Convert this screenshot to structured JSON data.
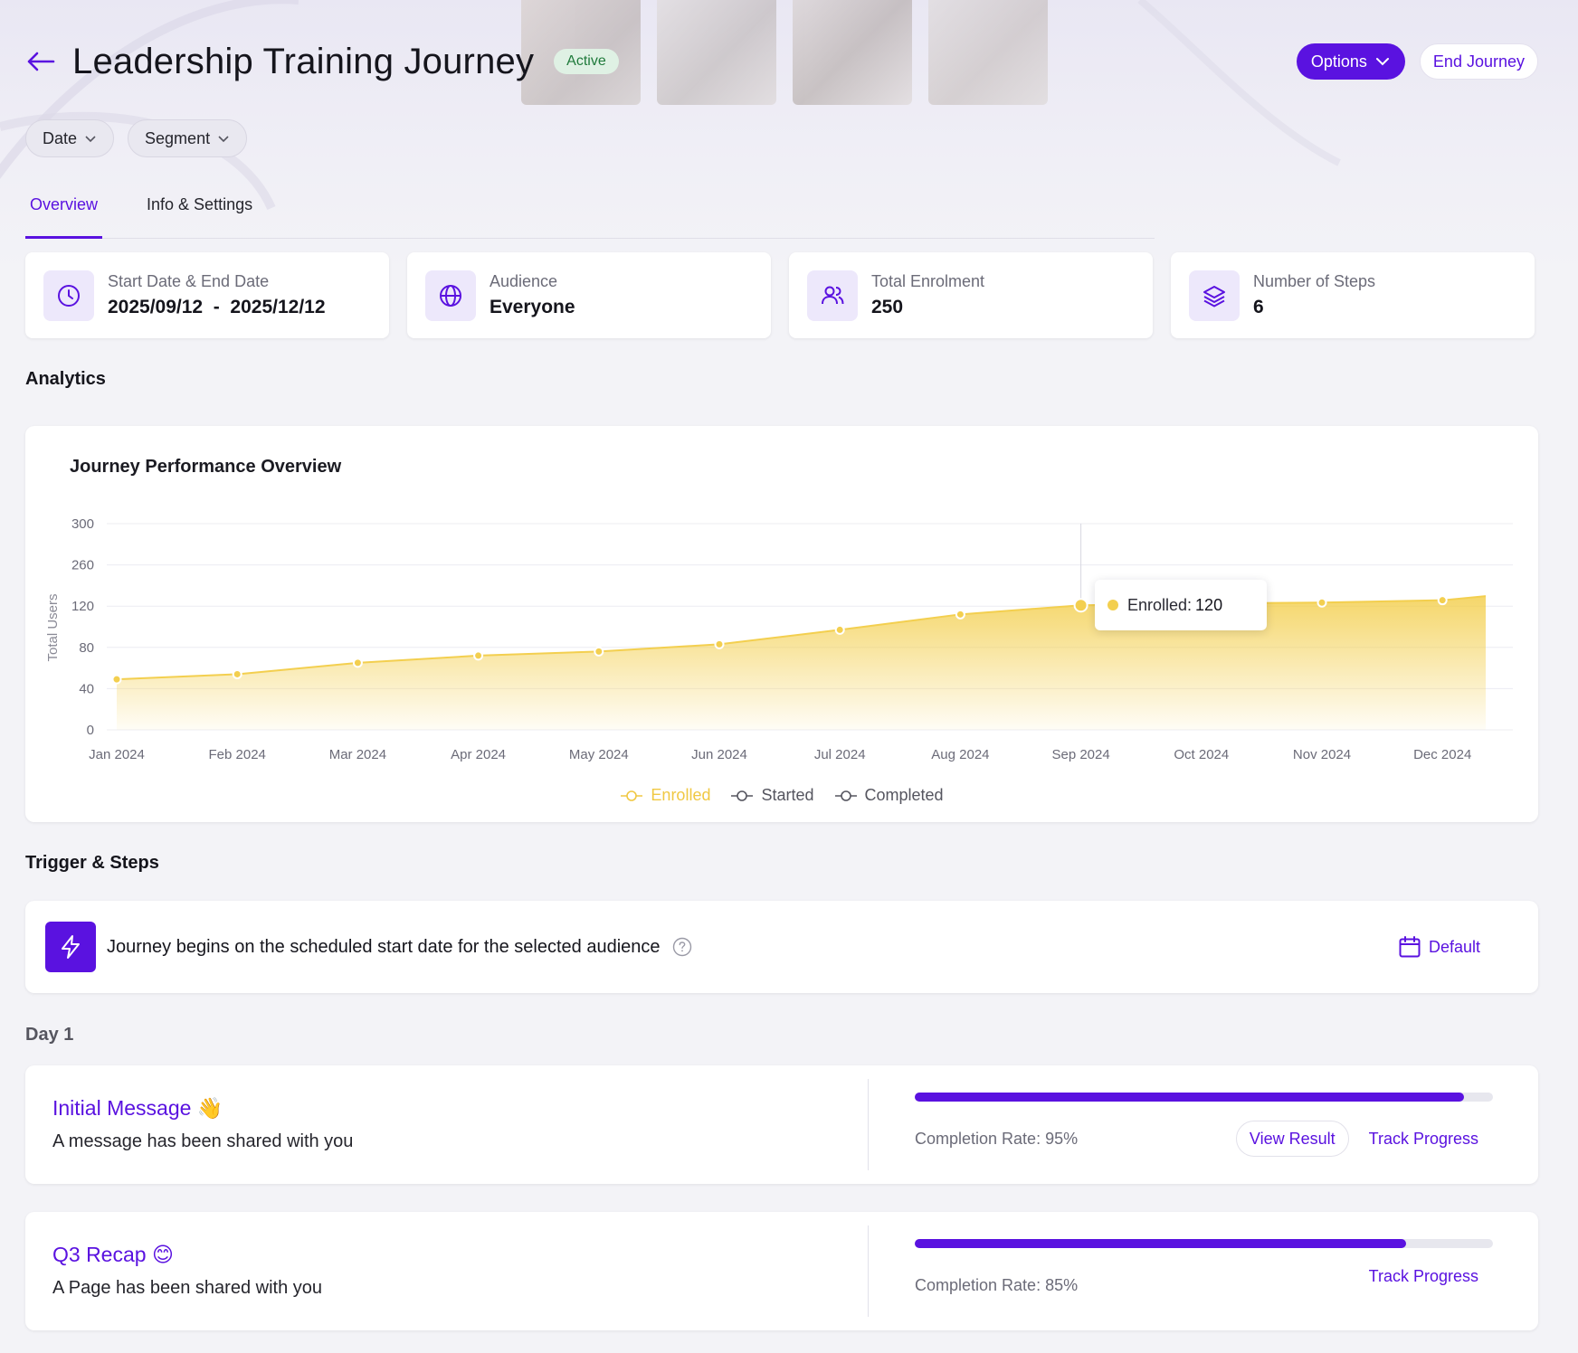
{
  "header": {
    "title": "Leadership Training Journey",
    "status": "Active",
    "options_label": "Options",
    "end_label": "End Journey"
  },
  "filters": {
    "date": "Date",
    "segment": "Segment"
  },
  "tabs": [
    {
      "label": "Overview",
      "active": true
    },
    {
      "label": "Info & Settings",
      "active": false
    }
  ],
  "stats": [
    {
      "icon": "clock-icon",
      "label": "Start Date & End Date",
      "value": "2025/09/12  -  2025/12/12"
    },
    {
      "icon": "globe-icon",
      "label": "Audience",
      "value": "Everyone"
    },
    {
      "icon": "users-icon",
      "label": "Total Enrolment",
      "value": "250"
    },
    {
      "icon": "layers-icon",
      "label": "Number of Steps",
      "value": "6"
    }
  ],
  "analytics": {
    "section_title": "Analytics",
    "tooltip_label": "Enrolled:",
    "tooltip_value": "120"
  },
  "chart_data": {
    "type": "area",
    "title": "Journey Performance Overview",
    "xlabel": "",
    "ylabel": "Total Users",
    "categories": [
      "Jan 2024",
      "Feb 2024",
      "Mar 2024",
      "Apr 2024",
      "May 2024",
      "Jun 2024",
      "Jul 2024",
      "Aug 2024",
      "Sep 2024",
      "Oct 2024",
      "Nov 2024",
      "Dec 2024"
    ],
    "y_ticks": [
      0,
      40,
      80,
      120,
      260,
      300
    ],
    "series": [
      {
        "name": "Enrolled",
        "values": [
          49,
          54,
          65,
          72,
          76,
          83,
          97,
          112,
          123,
          129,
          132,
          140
        ],
        "end_value": 154
      },
      {
        "name": "Started",
        "values": []
      },
      {
        "name": "Completed",
        "values": []
      }
    ],
    "highlight_category": "Sep 2024",
    "grid": true,
    "legend": "bottom-center"
  },
  "colors": {
    "accent": "#5a12e0",
    "enrolled": "#f3cf4f",
    "enrolled_text": "#f0c843",
    "legend_muted": "#55555f"
  },
  "trigger": {
    "section_title": "Trigger & Steps",
    "text": "Journey begins on the scheduled start date for the selected audience",
    "action_label": "Default"
  },
  "day_label": "Day 1",
  "steps": [
    {
      "title": "Initial Message",
      "emoji": "👋",
      "subtitle": "A message has been shared with you",
      "completion": 0.95,
      "rate_text": "Completion Rate: 95%",
      "view_label": "View Result",
      "track_label": "Track Progress"
    },
    {
      "title": "Q3 Recap",
      "emoji": "😊",
      "subtitle": "A Page has been shared with you",
      "completion": 0.85,
      "rate_text": "Completion Rate: 85%",
      "track_label": "Track Progress"
    }
  ]
}
